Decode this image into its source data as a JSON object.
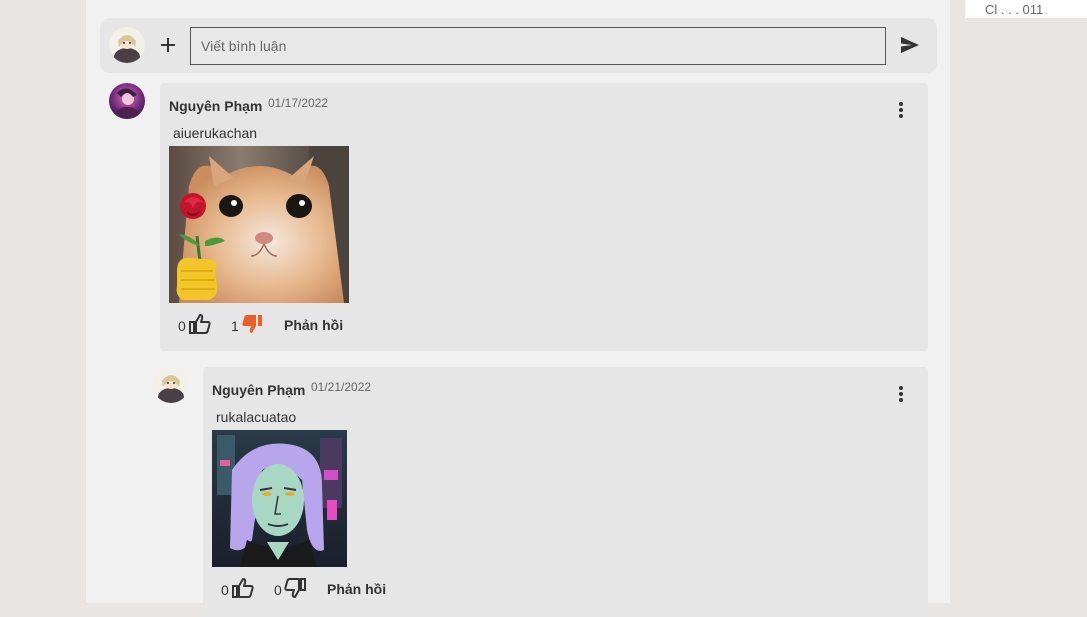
{
  "compose": {
    "placeholder": "Viết bình luận"
  },
  "right_panel": {
    "partial_text": "Cl . . . 011"
  },
  "comments": [
    {
      "author": "Nguyên Phạm",
      "date": "01/17/2022",
      "text": "aiuerukachan",
      "likes": "0",
      "dislikes": "1",
      "dislike_color": "#e8602c",
      "reply_label": "Phản hồi"
    },
    {
      "author": "Nguyên Phạm",
      "date": "01/21/2022",
      "text": "rukalacuatao",
      "likes": "0",
      "dislikes": "0",
      "dislike_color": "#333333",
      "reply_label": "Phản hồi"
    }
  ]
}
